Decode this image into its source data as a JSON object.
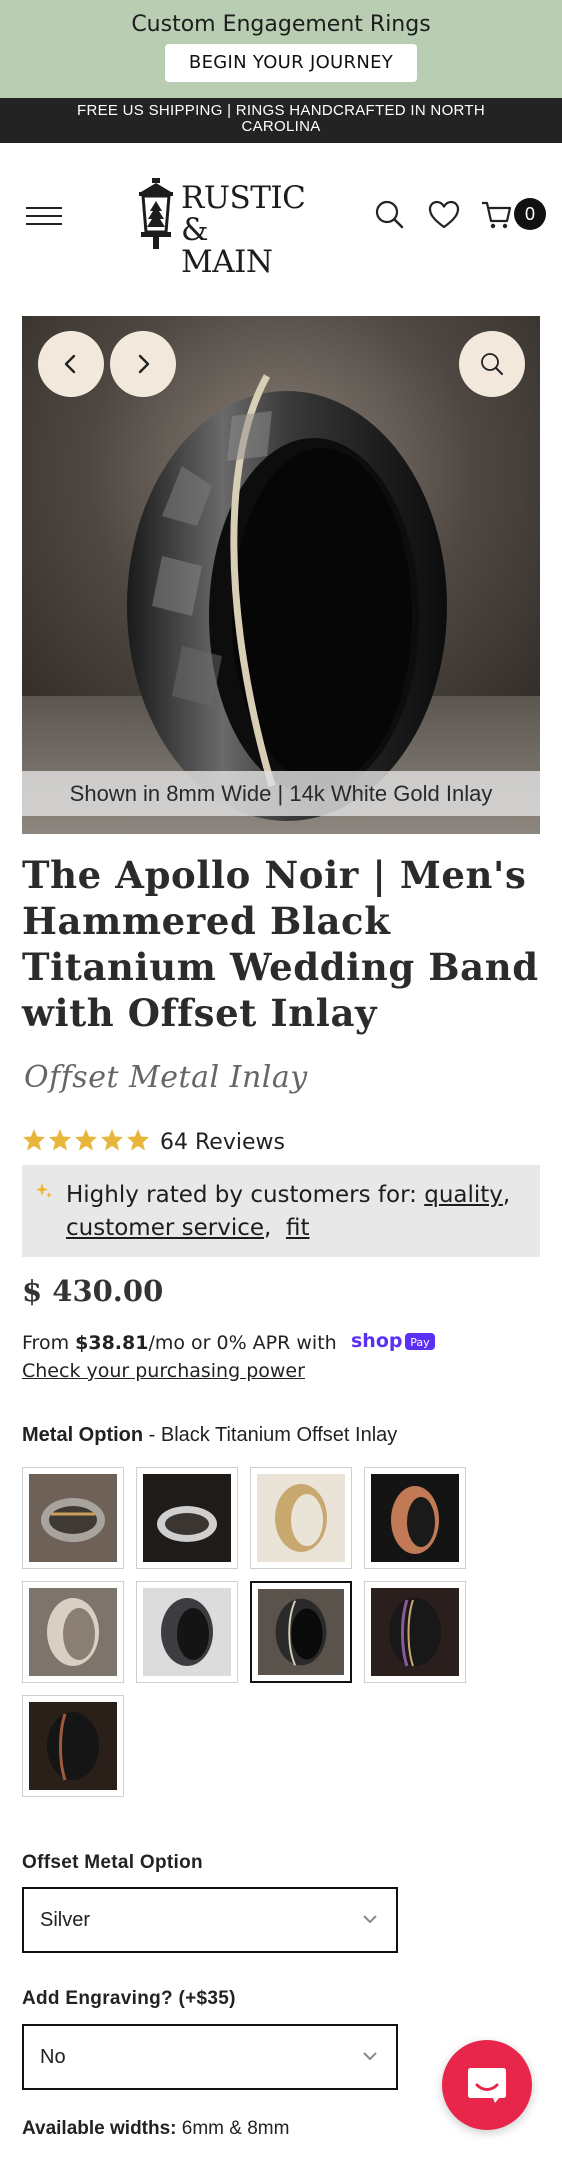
{
  "promo": {
    "title": "Custom Engagement Rings",
    "button": "BEGIN YOUR JOURNEY"
  },
  "shipping_bar": "FREE US SHIPPING | RINGS HANDCRAFTED IN NORTH CAROLINA",
  "header": {
    "logo_line1": "RUSTIC",
    "logo_line2": "& MAIN",
    "cart_count": "0",
    "icons": [
      "menu-icon",
      "search-icon",
      "heart-icon",
      "cart-icon"
    ]
  },
  "hero": {
    "caption": "Shown in 8mm Wide | 14k White Gold Inlay",
    "icons": [
      "chevron-left-icon",
      "chevron-right-icon",
      "zoom-icon"
    ]
  },
  "product": {
    "title": "The Apollo Noir | Men's Hammered Black Titanium Wedding Band with Offset Inlay",
    "subtitle": "Offset Metal Inlay",
    "rating_stars": 5,
    "reviews": "64 Reviews",
    "rated_prefix": "Highly rated by customers for: ",
    "rated_tags": [
      "quality",
      "customer service",
      "fit"
    ],
    "price": "$ 430.00",
    "financing_prefix": "From ",
    "financing_amount": "$38.81",
    "financing_suffix": "/mo or 0% APR with",
    "financing_brand": "shop",
    "financing_brand_badge": "Pay",
    "purchasing_power": "Check your purchasing power"
  },
  "metal_option": {
    "label": "Metal Option",
    "separator": " - ",
    "selected": "Black Titanium Offset Inlay",
    "selected_index": 6,
    "swatch_count": 9
  },
  "offset_metal": {
    "label": "Offset Metal Option",
    "value": "Silver"
  },
  "engraving": {
    "label": "Add Engraving? (+$35)",
    "value": "No"
  },
  "widths": {
    "label": "Available widths:",
    "value": "6mm & 8mm"
  },
  "colors": {
    "promo_bg": "#b9cdb2",
    "shipbar_bg": "#232323",
    "star": "#e8b63c",
    "chat": "#e8254a",
    "shop_pay": "#5a31f4"
  }
}
